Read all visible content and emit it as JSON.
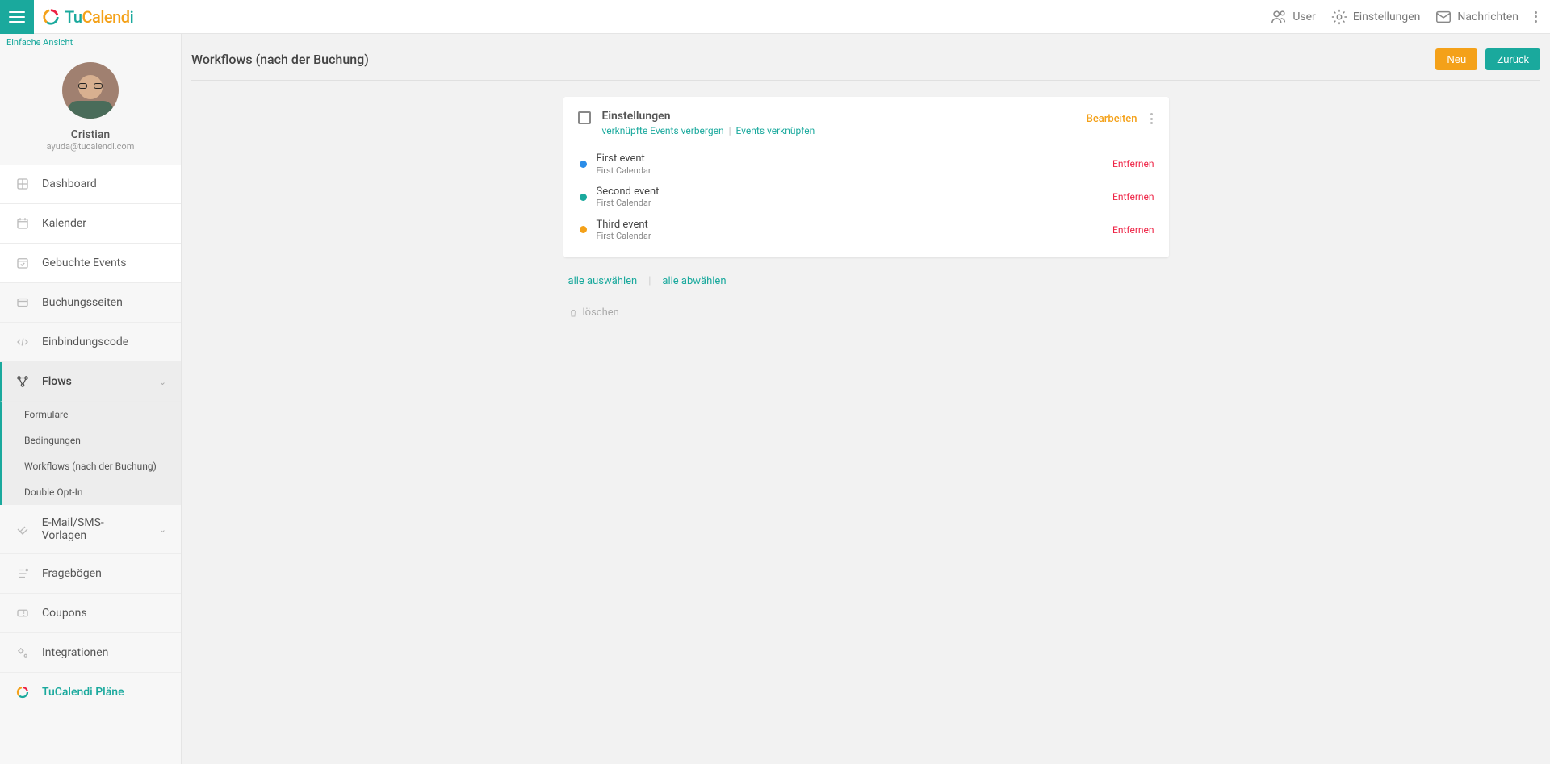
{
  "brand": {
    "part1": "Tu",
    "part2": "Calend",
    "part3": "i"
  },
  "topbar": {
    "user": "User",
    "settings": "Einstellungen",
    "messages": "Nachrichten"
  },
  "sidebar": {
    "simple_view": "Einfache Ansicht",
    "profile": {
      "name": "Cristian",
      "email": "ayuda@tucalendi.com"
    },
    "items": {
      "dashboard": "Dashboard",
      "calendar": "Kalender",
      "booked": "Gebuchte Events",
      "booking_pages": "Buchungsseiten",
      "embed": "Einbindungscode",
      "flows": "Flows",
      "emailsms": "E-Mail/SMS-Vorlagen",
      "surveys": "Fragebögen",
      "coupons": "Coupons",
      "integrations": "Integrationen",
      "plans": "TuCalendi Pläne"
    },
    "flows_sub": {
      "forms": "Formulare",
      "conditions": "Bedingungen",
      "workflows": "Workflows (nach der Buchung)",
      "double_opt": "Double Opt-In"
    }
  },
  "page": {
    "title": "Workflows (nach der Buchung)",
    "new_btn": "Neu",
    "back_btn": "Zurück"
  },
  "card": {
    "title": "Einstellungen",
    "hide_linked": "verknüpfte Events verbergen",
    "link_events": "Events verknüpfen",
    "edit": "Bearbeiten",
    "remove": "Entfernen",
    "events": [
      {
        "name": "First event",
        "calendar": "First Calendar",
        "color": "#2b8de8"
      },
      {
        "name": "Second event",
        "calendar": "First Calendar",
        "color": "#1aa99d"
      },
      {
        "name": "Third event",
        "calendar": "First Calendar",
        "color": "#f4a119"
      }
    ]
  },
  "bulk": {
    "select_all": "alle auswählen",
    "deselect_all": "alle abwählen",
    "delete": "löschen"
  }
}
